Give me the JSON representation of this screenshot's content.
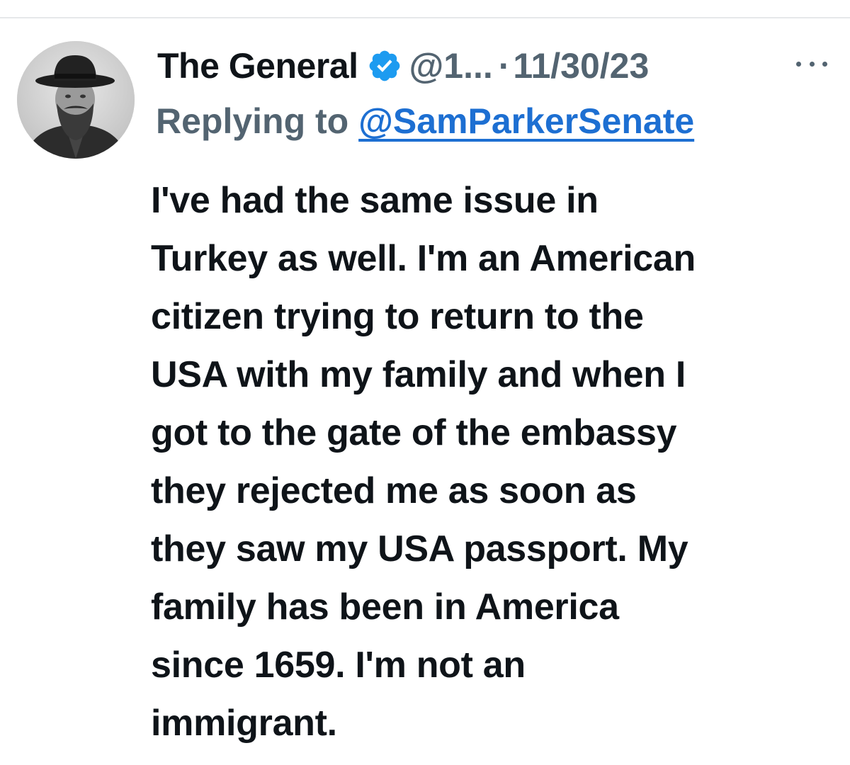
{
  "tweet": {
    "display_name": "The General",
    "verified": true,
    "handle": "@1...",
    "separator": "·",
    "timestamp": "11/30/23",
    "replying_prefix": "Replying to",
    "replying_to": "@SamParkerSenate",
    "body_lines": [
      "I've had the same issue in",
      "Turkey as well. I'm an American",
      "citizen trying to return to the",
      "USA with my family and when I",
      "got to the gate of the embassy",
      "they rejected me as soon as",
      "they saw my USA passport. My",
      "family has been in America",
      "since 1659. I'm not an",
      "immigrant."
    ]
  },
  "icons": {
    "verified": "verified-badge-icon",
    "more": "more-options-icon",
    "avatar": "profile-photo"
  },
  "colors": {
    "text_primary": "#0f1419",
    "text_secondary": "#536471",
    "link": "#1d6fd2",
    "verified_badge": "#1d9bf0"
  }
}
